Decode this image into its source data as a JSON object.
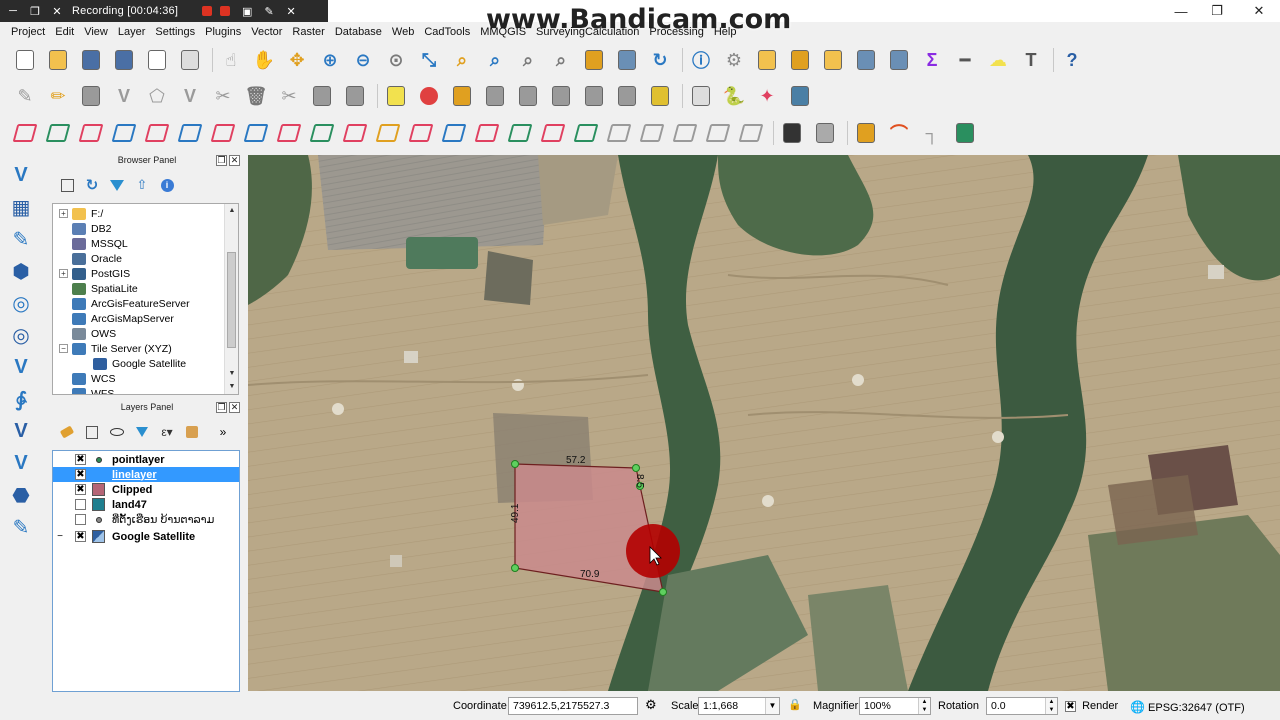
{
  "recording": {
    "text": "Recording [00:04:36]"
  },
  "watermark": "www.Bandicam.com",
  "menu": [
    "Project",
    "Edit",
    "View",
    "Layer",
    "Settings",
    "Plugins",
    "Vector",
    "Raster",
    "Database",
    "Web",
    "CadTools",
    "MMQGIS",
    "SurveyingCalculation",
    "Processing",
    "Help"
  ],
  "browser_panel": {
    "title": "Browser Panel",
    "items": [
      {
        "label": "F:/",
        "expander": "+",
        "icon": "folder-icon",
        "color": "#f2c14e"
      },
      {
        "label": "DB2",
        "expander": "",
        "icon": "db2-icon",
        "color": "#5b7fb4"
      },
      {
        "label": "MSSQL",
        "expander": "",
        "icon": "mssql-icon",
        "color": "#6b6b9a"
      },
      {
        "label": "Oracle",
        "expander": "",
        "icon": "oracle-icon",
        "color": "#4a6f9a"
      },
      {
        "label": "PostGIS",
        "expander": "+",
        "icon": "postgis-icon",
        "color": "#335f8c"
      },
      {
        "label": "SpatiaLite",
        "expander": "",
        "icon": "spatialite-icon",
        "color": "#4d7f4d"
      },
      {
        "label": "ArcGisFeatureServer",
        "expander": "",
        "icon": "globe-icon",
        "color": "#3e7ab8"
      },
      {
        "label": "ArcGisMapServer",
        "expander": "",
        "icon": "globe-icon",
        "color": "#3e7ab8"
      },
      {
        "label": "OWS",
        "expander": "",
        "icon": "ows-icon",
        "color": "#7a8a9a"
      },
      {
        "label": "Tile Server (XYZ)",
        "expander": "−",
        "icon": "globe-icon",
        "color": "#3e7ab8"
      },
      {
        "label": "Google Satellite",
        "expander": "",
        "icon": "tile-icon",
        "color": "#2f5f9f",
        "indent": true
      },
      {
        "label": "WCS",
        "expander": "",
        "icon": "globe-icon",
        "color": "#3e7ab8"
      },
      {
        "label": "WFS",
        "expander": "",
        "icon": "globe-icon",
        "color": "#3e7ab8"
      }
    ]
  },
  "layers_panel": {
    "title": "Layers Panel",
    "layers": [
      {
        "name": "pointlayer",
        "checked": true,
        "symbol": "point",
        "color": "#2e8b57",
        "bold": true,
        "selected": false
      },
      {
        "name": "linelayer",
        "checked": true,
        "symbol": "line",
        "color": "#ffffff",
        "bold": true,
        "selected": true
      },
      {
        "name": "Clipped",
        "checked": true,
        "symbol": "fill",
        "color": "#b56576",
        "bold": true,
        "selected": false
      },
      {
        "name": "land47",
        "checked": false,
        "symbol": "fill",
        "color": "#1f7f8f",
        "bold": true,
        "selected": false
      },
      {
        "name": "ທີ່ຕັ້ງເຮືອນ ບ້ານຕາລາມ",
        "checked": false,
        "symbol": "point",
        "color": "#888888",
        "bold": false,
        "selected": false
      },
      {
        "name": "Google Satellite",
        "checked": true,
        "symbol": "raster",
        "color": "#2f5f9f",
        "bold": true,
        "selected": false,
        "expander": "−"
      }
    ]
  },
  "map": {
    "polygon_labels": [
      "57.2",
      "8.5",
      "49.1",
      "70.9"
    ],
    "polygon_color": "#c98a8c",
    "highlight_color": "#b30000"
  },
  "status": {
    "coordinate_label": "Coordinate",
    "coordinate_value": "739612.5,2175527.3",
    "scale_label": "Scale",
    "scale_value": "1:1,668",
    "magnifier_label": "Magnifier",
    "magnifier_value": "100%",
    "rotation_label": "Rotation",
    "rotation_value": "0.0",
    "render_label": "Render",
    "crs": "EPSG:32647 (OTF)"
  }
}
